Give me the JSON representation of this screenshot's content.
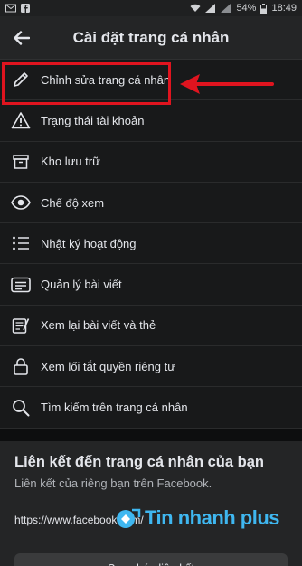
{
  "status_bar": {
    "battery": "54%",
    "time": "18:49"
  },
  "header": {
    "title": "Cài đặt trang cá nhân"
  },
  "menu": {
    "items": [
      {
        "label": "Chỉnh sửa trang cá nhân",
        "icon": "pencil-icon"
      },
      {
        "label": "Trạng thái tài khoản",
        "icon": "warning-icon"
      },
      {
        "label": "Kho lưu trữ",
        "icon": "archive-icon"
      },
      {
        "label": "Chế độ xem",
        "icon": "eye-icon"
      },
      {
        "label": "Nhật ký hoạt động",
        "icon": "list-icon"
      },
      {
        "label": "Quản lý bài viết",
        "icon": "posts-icon"
      },
      {
        "label": "Xem lại bài viết và thẻ",
        "icon": "review-icon"
      },
      {
        "label": "Xem lối tắt quyền riêng tư",
        "icon": "lock-icon"
      },
      {
        "label": "Tìm kiếm trên trang cá nhân",
        "icon": "search-icon"
      }
    ]
  },
  "link_section": {
    "title": "Liên kết đến trang cá nhân của bạn",
    "subtitle": "Liên kết của riêng bạn trên Facebook.",
    "url": "https://www.facebook.com/",
    "copy_button": "Sao chép liên kết"
  },
  "watermark": {
    "text": "Tin nhanh plus"
  },
  "colors": {
    "highlight": "#e0141f",
    "watermark": "#3fb7f0",
    "background": "#18191a"
  }
}
